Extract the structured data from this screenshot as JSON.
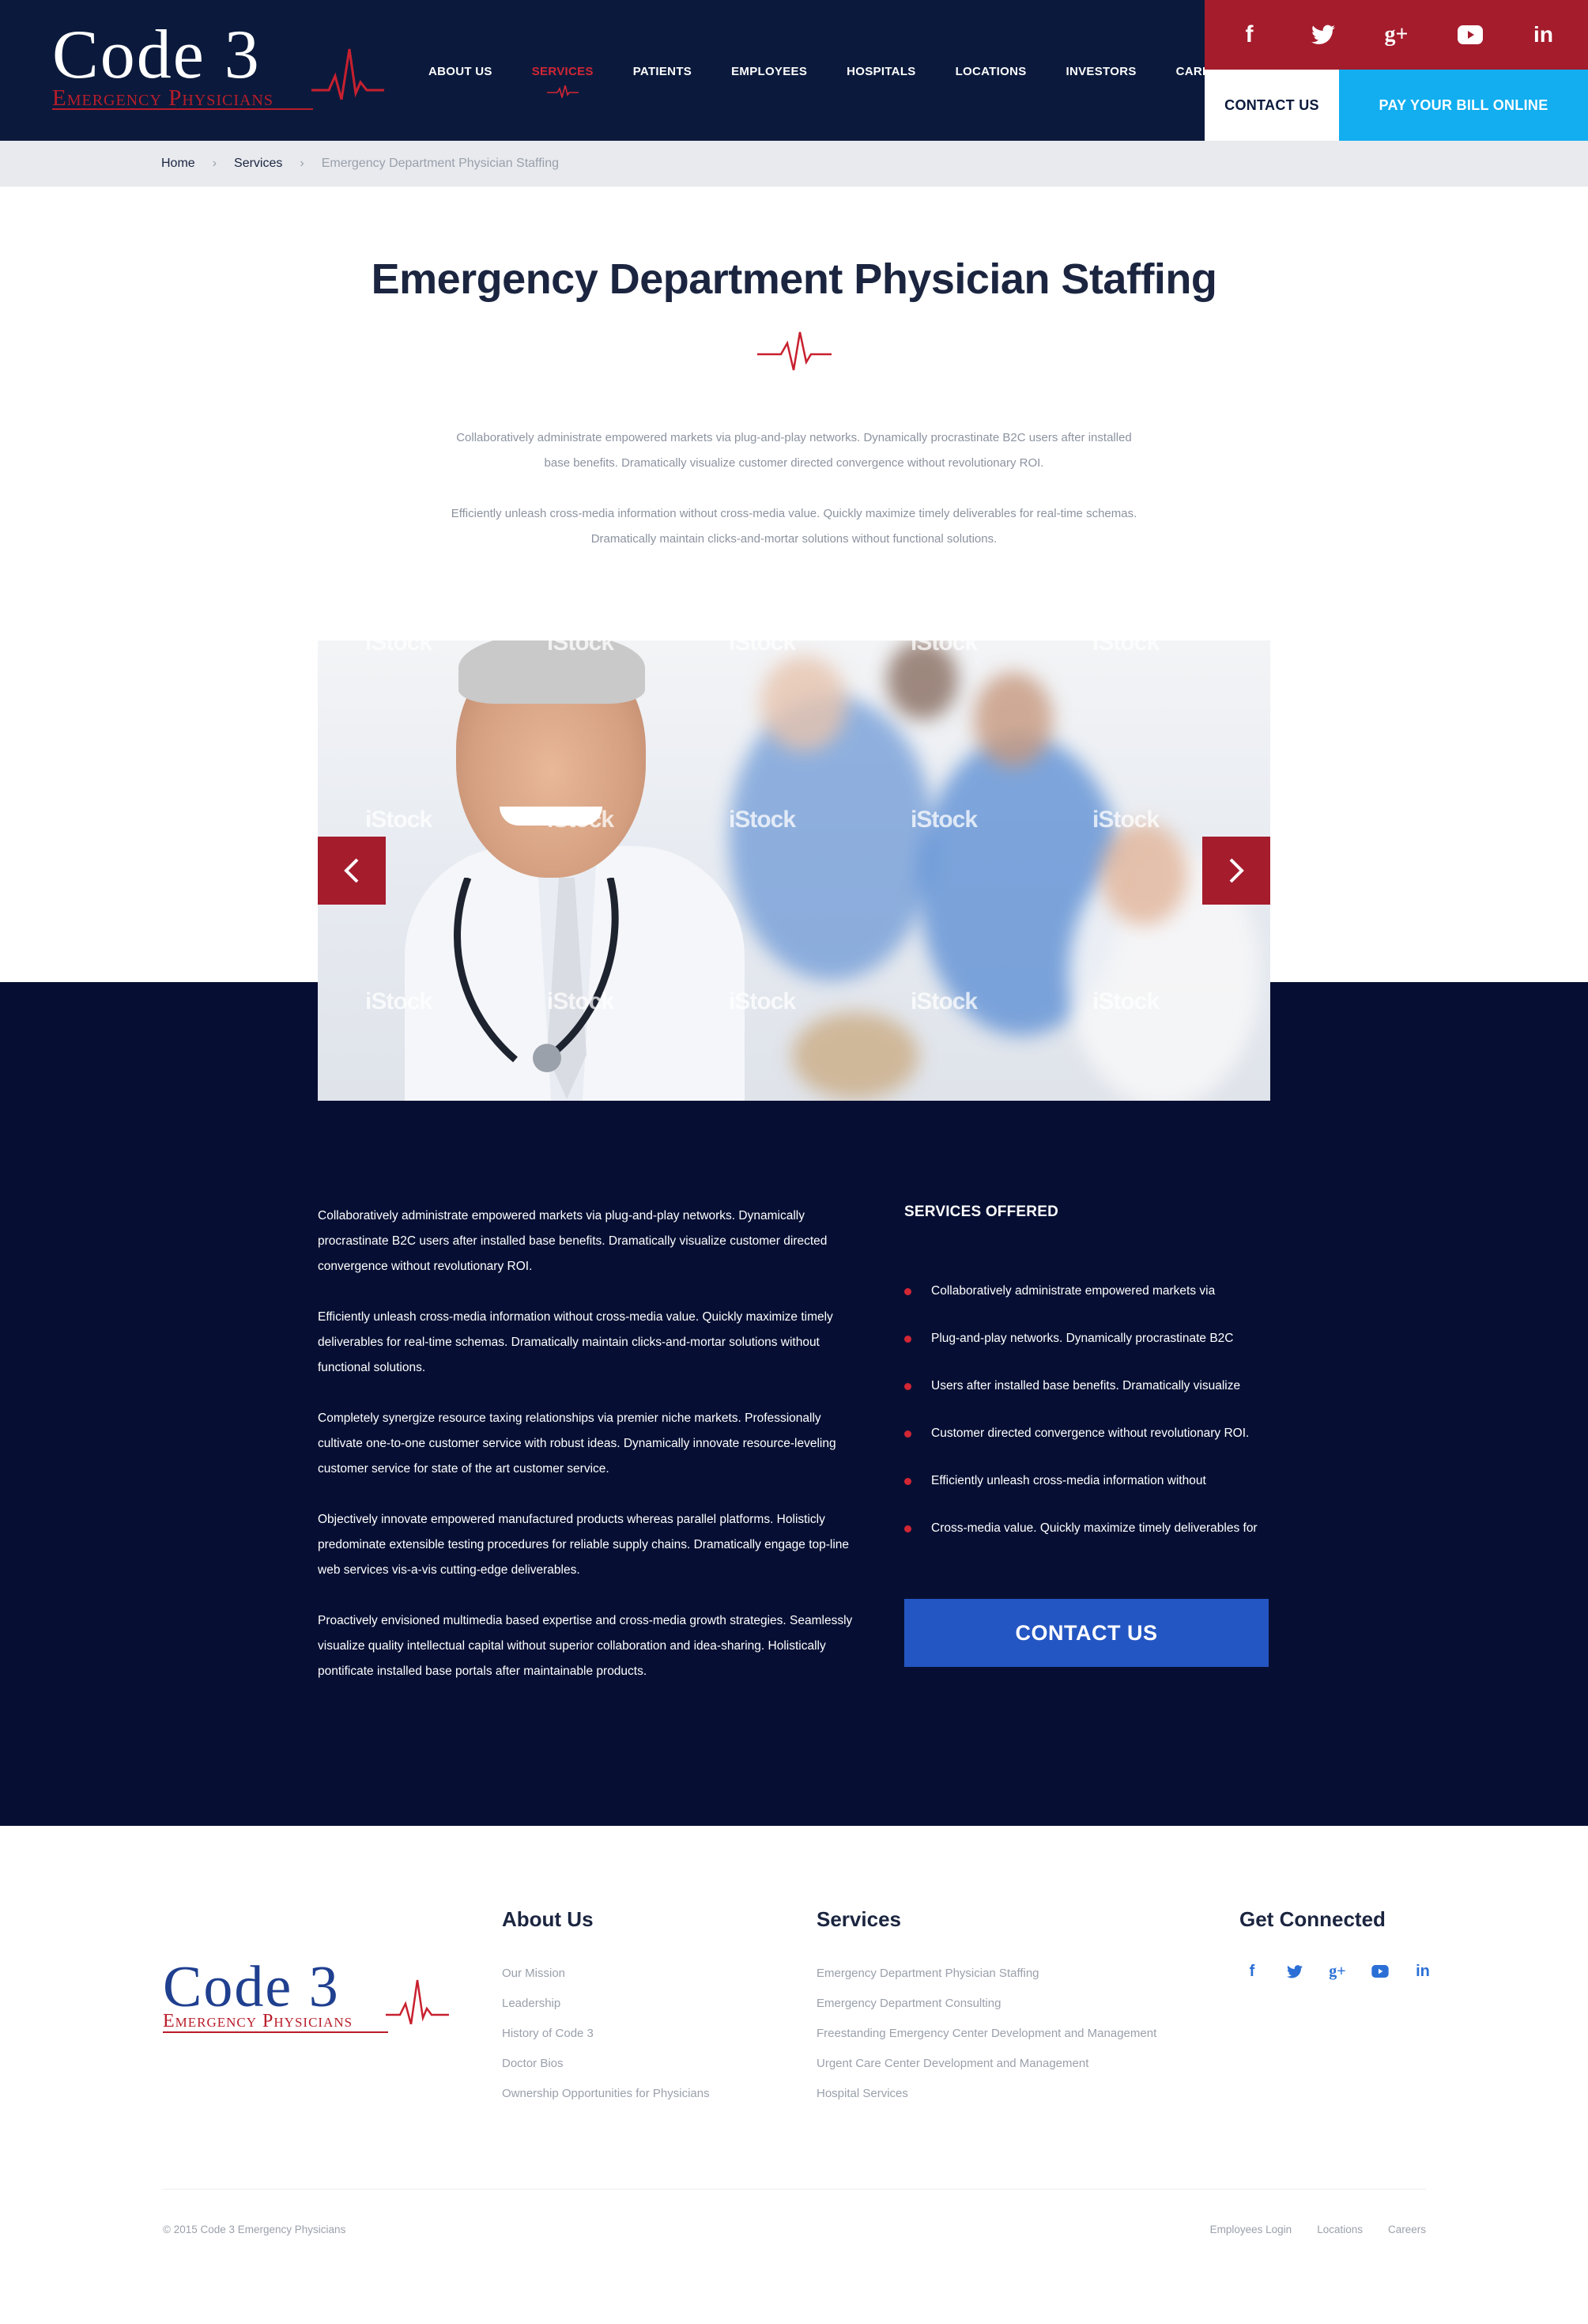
{
  "brand": {
    "logo_main": "Code 3",
    "logo_sub": "Emergency Physicians",
    "colors": {
      "navy": "#0b1a3c",
      "red": "#a51c2d",
      "cyan": "#12aef0",
      "blue": "#2456c3"
    }
  },
  "nav": {
    "items": [
      {
        "label": "ABOUT US"
      },
      {
        "label": "SERVICES",
        "active": true
      },
      {
        "label": "PATIENTS"
      },
      {
        "label": "EMPLOYEES"
      },
      {
        "label": "HOSPITALS"
      },
      {
        "label": "LOCATIONS"
      },
      {
        "label": "INVESTORS"
      },
      {
        "label": "CAREERS"
      }
    ]
  },
  "social": {
    "facebook": "f",
    "twitter": "twitter-icon",
    "googleplus": "g+",
    "youtube": "youtube-icon",
    "linkedin": "in"
  },
  "header_actions": {
    "contact": "CONTACT US",
    "pay": "PAY YOUR BILL ONLINE"
  },
  "breadcrumb": {
    "home": "Home",
    "services": "Services",
    "current": "Emergency Department Physician Staffing"
  },
  "page": {
    "title": "Emergency Department Physician Staffing",
    "intro": [
      "Collaboratively administrate empowered markets via plug-and-play networks. Dynamically procrastinate B2C users after installed base benefits. Dramatically visualize customer directed convergence without revolutionary ROI.",
      "Efficiently unleash cross-media information without cross-media value. Quickly maximize timely deliverables for real-time schemas. Dramatically maintain clicks-and-mortar solutions without functional solutions."
    ]
  },
  "slider": {
    "watermark": "iStock"
  },
  "content": {
    "paragraphs": [
      "Collaboratively administrate empowered markets via plug-and-play networks. Dynamically procrastinate B2C users after installed base benefits. Dramatically visualize customer directed convergence without revolutionary ROI.",
      "Efficiently unleash cross-media information without cross-media value. Quickly maximize timely deliverables for real-time schemas. Dramatically maintain clicks-and-mortar solutions without functional solutions.",
      "Completely synergize resource taxing relationships via premier niche markets. Professionally cultivate one-to-one customer service with robust ideas. Dynamically innovate resource-leveling customer service for state of the art customer service.",
      "Objectively innovate empowered manufactured products whereas parallel platforms. Holisticly predominate extensible testing procedures for reliable supply chains. Dramatically engage top-line web services vis-a-vis cutting-edge deliverables.",
      "Proactively envisioned multimedia based expertise and cross-media growth strategies. Seamlessly visualize quality intellectual capital without superior collaboration and idea-sharing. Holistically pontificate installed base portals after maintainable products."
    ],
    "services_heading": "SERVICES OFFERED",
    "services": [
      "Collaboratively administrate empowered markets via",
      "Plug-and-play networks. Dynamically procrastinate B2C",
      "Users after installed base benefits. Dramatically visualize",
      "Customer directed convergence without revolutionary ROI.",
      "Efficiently unleash cross-media information without",
      "Cross-media value. Quickly maximize timely deliverables for"
    ],
    "contact_button": "CONTACT US"
  },
  "footer": {
    "about": {
      "heading": "About Us",
      "links": [
        "Our Mission",
        "Leadership",
        "History of Code 3",
        "Doctor Bios",
        "Ownership Opportunities for Physicians"
      ]
    },
    "services": {
      "heading": "Services",
      "links": [
        "Emergency Department Physician Staffing",
        "Emergency Department Consulting",
        "Freestanding Emergency Center Development and Management",
        "Urgent Care Center Development and Management",
        "Hospital Services"
      ]
    },
    "connect": {
      "heading": "Get Connected"
    },
    "copyright": "© 2015 Code 3 Emergency Physicians",
    "bottom_links": [
      "Employees Login",
      "Locations",
      "Careers"
    ]
  }
}
